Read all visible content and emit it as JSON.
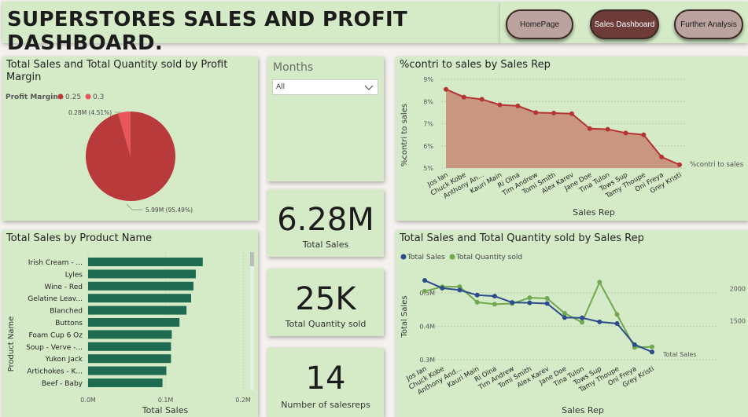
{
  "header": {
    "title": "SUPERSTORES SALES AND PROFIT DASHBOARD."
  },
  "nav": {
    "homepage_label": "HomePage",
    "sales_dashboard_label": "Sales Dashboard",
    "further_analysis_label": "Further Analysis"
  },
  "filter": {
    "title": "Months",
    "selected": "All"
  },
  "cards": {
    "total_sales": {
      "value": "6.28M",
      "label": "Total Sales"
    },
    "total_quantity": {
      "value": "25K",
      "label": "Total Quantity sold"
    },
    "salesreps": {
      "value": "14",
      "label": "Number of salesreps"
    }
  },
  "colors": {
    "panel_bg": "#d5ebc8",
    "pie_main": "#b83a3b",
    "pie_small": "#e8555a",
    "bar_green": "#1e6b52",
    "area_fill": "#c9967f",
    "line_red": "#b63333",
    "line_blue": "#2b4c8c",
    "line_green": "#6fa84f",
    "nav_active": "#6d3c38",
    "nav_inactive": "#bba3a0"
  },
  "pie_chart": {
    "title": "Total Sales and Total Quantity sold by Profit Margin",
    "legend_title": "Profit Margin",
    "slice_labels": [
      "5.99M (95.49%)",
      "0.28M (4.51%)"
    ],
    "chart_data": {
      "type": "pie",
      "categories": [
        "0.25",
        "0.3"
      ],
      "values": [
        5.99,
        0.28
      ],
      "unit": "M",
      "percentages": [
        95.49,
        4.51
      ]
    }
  },
  "bar_chart": {
    "title": "Total Sales by Product Name",
    "chart_data": {
      "type": "bar",
      "orientation": "horizontal",
      "categories": [
        "Irish Cream - ...",
        "Lyles",
        "Wine - Red",
        "Gelatine Leav...",
        "Blanched",
        "Buttons",
        "Foam Cup 6 Oz",
        "Soup - Verve -...",
        "Yukon Jack",
        "Artichokes - K...",
        "Beef - Baby"
      ],
      "values": [
        0.148,
        0.139,
        0.136,
        0.133,
        0.127,
        0.118,
        0.108,
        0.107,
        0.107,
        0.101,
        0.096
      ],
      "ylabel": "Product Name",
      "xlabel": "Total Sales",
      "ticks": [
        "0.0M",
        "0.1M",
        "0.2M"
      ],
      "xlim": [
        0,
        0.2
      ]
    }
  },
  "contri_chart": {
    "title": "%contri to sales by Sales Rep",
    "series_label": "%contri to sales",
    "chart_data": {
      "type": "area",
      "categories": [
        "Jos Ian",
        "Chuck Kobe",
        "Anthony An...",
        "Kauri Main",
        "Ri Olna",
        "Tim Andrew",
        "Tomi Smith",
        "Alex Karev",
        "Jane Doe",
        "Tina Tulon",
        "Tows Sup",
        "Tamy Thoupe",
        "Oni Freya",
        "Grey Kristi"
      ],
      "values": [
        8.55,
        8.2,
        8.1,
        7.85,
        7.8,
        7.5,
        7.48,
        7.45,
        6.78,
        6.75,
        6.58,
        6.5,
        5.5,
        5.15
      ],
      "ylabel": "%contri to sales",
      "xlabel": "Sales Rep",
      "yticks": [
        "5%",
        "6%",
        "7%",
        "8%",
        "9%"
      ],
      "ylim": [
        5,
        9
      ],
      "grid": true
    }
  },
  "line_chart": {
    "title": "Total Sales and Total Quantity sold by Sales Rep",
    "legend": [
      "Total Sales",
      "Total Quantity sold"
    ],
    "end_label": "Total Sales",
    "chart_data": {
      "type": "line",
      "categories": [
        "Jos Ian",
        "Chuck Kobe",
        "Anthony And...",
        "Kauri Main",
        "Ri Olna",
        "Tim Andrew",
        "Tomi Smith",
        "Alex Karev",
        "Jane Doe",
        "Tina Tulon",
        "Tows Sup",
        "Tamy Thoupe",
        "Oni Freya",
        "Grey Kristi"
      ],
      "series": [
        {
          "name": "Total Sales",
          "axis": "left",
          "values": [
            0.537,
            0.514,
            0.508,
            0.493,
            0.49,
            0.471,
            0.47,
            0.468,
            0.426,
            0.425,
            0.413,
            0.408,
            0.345,
            0.323
          ]
        },
        {
          "name": "Total Quantity sold",
          "axis": "right",
          "values": [
            1960,
            2030,
            2030,
            1790,
            1760,
            1770,
            1860,
            1850,
            1620,
            1480,
            2100,
            1600,
            1090,
            1100
          ]
        }
      ],
      "ylabel": "Total Sales",
      "xlabel": "Sales Rep",
      "yticks_left": [
        "0.3M",
        "0.4M",
        "0.5M"
      ],
      "ylim_left": [
        0.3,
        0.57
      ],
      "yticks_right": [
        "1500",
        "2000"
      ],
      "ylim_right": [
        900,
        2300
      ],
      "grid": true
    }
  }
}
